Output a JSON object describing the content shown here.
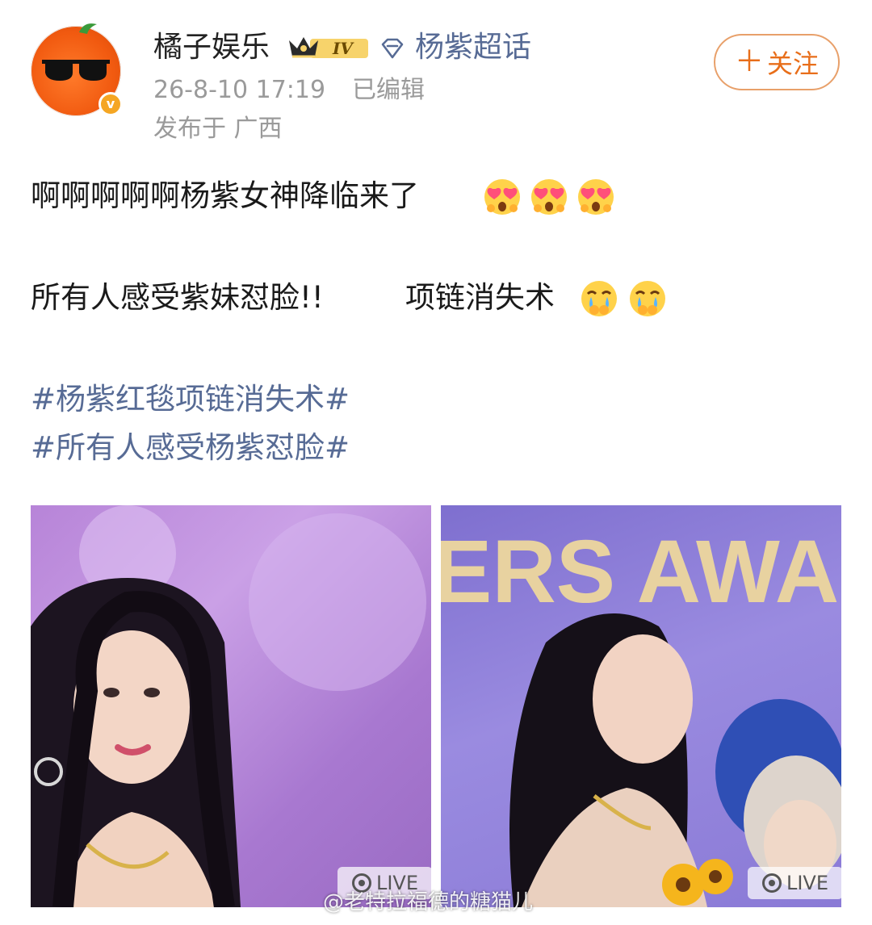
{
  "post": {
    "author": "橘子娱乐",
    "level_badge": "IV",
    "super_topic": "杨紫超话",
    "follow_label": "关注",
    "follow_plus": "＋",
    "timestamp": "26-8-10 17:19",
    "edited_label": "已编辑",
    "location": "发布于 广西",
    "verified_mark": "v"
  },
  "content": {
    "line1": "啊啊啊啊啊杨紫女神降临来了",
    "line2": "所有人感受紫妹怼脸!!",
    "line2b": "项链消失术",
    "hashtags": [
      "#杨紫红毯项链消失术#",
      "#所有人感受杨紫怼脸#"
    ]
  },
  "photos": [
    {
      "live_label": "LIVE"
    },
    {
      "live_label": "LIVE"
    }
  ],
  "watermark": "@老特拉福德的糖猫儿",
  "icons": [
    "avatar-sunglasses-orange",
    "crown-icon",
    "super-topic-diamond-icon",
    "love-eyes-emoji",
    "touched-tears-emoji",
    "live-icon"
  ],
  "colors": {
    "link": "#576b95",
    "follow": "#e86e1a",
    "meta": "#9a9a9a"
  }
}
